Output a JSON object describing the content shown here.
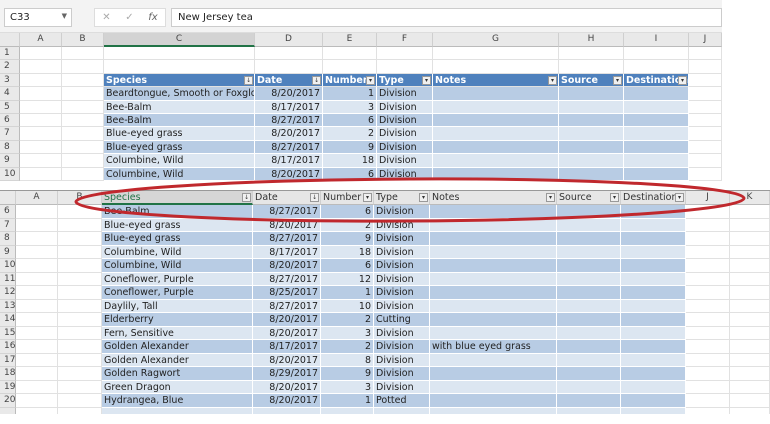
{
  "formula_bar": {
    "name_box": "C33",
    "cancel_icon": "✕",
    "enter_icon": "✓",
    "fx_label": "fx",
    "value": "New Jersey tea"
  },
  "top_pane": {
    "column_letters": [
      "A",
      "B",
      "C",
      "D",
      "E",
      "F",
      "G",
      "H",
      "I",
      "J"
    ],
    "row_numbers": [
      "1",
      "2",
      "3",
      "4",
      "5",
      "6",
      "7",
      "8",
      "9",
      "10"
    ],
    "table_headers": [
      "Species",
      "Date",
      "Number",
      "Type",
      "Notes",
      "Source",
      "Destination"
    ],
    "rows": [
      [
        "Beardtongue, Smooth or Foxglove",
        "8/20/2017",
        "1",
        "Division",
        "",
        "",
        ""
      ],
      [
        "Bee-Balm",
        "8/17/2017",
        "3",
        "Division",
        "",
        "",
        ""
      ],
      [
        "Bee-Balm",
        "8/27/2017",
        "6",
        "Division",
        "",
        "",
        ""
      ],
      [
        "Blue-eyed grass",
        "8/20/2017",
        "2",
        "Division",
        "",
        "",
        ""
      ],
      [
        "Blue-eyed grass",
        "8/27/2017",
        "9",
        "Division",
        "",
        "",
        ""
      ],
      [
        "Columbine, Wild",
        "8/17/2017",
        "18",
        "Division",
        "",
        "",
        ""
      ],
      [
        "Columbine, Wild",
        "8/20/2017",
        "6",
        "Division",
        "",
        "",
        ""
      ]
    ]
  },
  "bottom_pane": {
    "column_headers": [
      "A",
      "B",
      "Species",
      "Date",
      "Number",
      "Type",
      "Notes",
      "Source",
      "Destination",
      "J",
      "K"
    ],
    "row_numbers": [
      "6",
      "7",
      "8",
      "9",
      "10",
      "11",
      "12",
      "13",
      "14",
      "15",
      "16",
      "17",
      "18",
      "19",
      "20"
    ],
    "rows": [
      [
        "Bee-Balm",
        "8/27/2017",
        "6",
        "Division",
        "",
        "",
        ""
      ],
      [
        "Blue-eyed grass",
        "8/20/2017",
        "2",
        "Division",
        "",
        "",
        ""
      ],
      [
        "Blue-eyed grass",
        "8/27/2017",
        "9",
        "Division",
        "",
        "",
        ""
      ],
      [
        "Columbine, Wild",
        "8/17/2017",
        "18",
        "Division",
        "",
        "",
        ""
      ],
      [
        "Columbine, Wild",
        "8/20/2017",
        "6",
        "Division",
        "",
        "",
        ""
      ],
      [
        "Coneflower, Purple",
        "8/27/2017",
        "12",
        "Division",
        "",
        "",
        ""
      ],
      [
        "Coneflower, Purple",
        "8/25/2017",
        "1",
        "Division",
        "",
        "",
        ""
      ],
      [
        "Daylily, Tall",
        "8/27/2017",
        "10",
        "Division",
        "",
        "",
        ""
      ],
      [
        "Elderberry",
        "8/20/2017",
        "2",
        "Cutting",
        "",
        "",
        ""
      ],
      [
        "Fern, Sensitive",
        "8/20/2017",
        "3",
        "Division",
        "",
        "",
        ""
      ],
      [
        "Golden Alexander",
        "8/17/2017",
        "2",
        "Division",
        "with blue eyed grass",
        "",
        ""
      ],
      [
        "Golden Alexander",
        "8/20/2017",
        "8",
        "Division",
        "",
        "",
        ""
      ],
      [
        "Golden Ragwort",
        "8/29/2017",
        "9",
        "Division",
        "",
        "",
        ""
      ],
      [
        "Green Dragon",
        "8/20/2017",
        "3",
        "Division",
        "",
        "",
        ""
      ],
      [
        "Hydrangea, Blue",
        "8/20/2017",
        "1",
        "Potted",
        "",
        "",
        ""
      ]
    ]
  },
  "colors": {
    "table_header": "#4f81bd",
    "band_dark": "#b8cce4",
    "band_light": "#dce6f1",
    "annotation": "#c0282d",
    "selection": "#217346"
  }
}
